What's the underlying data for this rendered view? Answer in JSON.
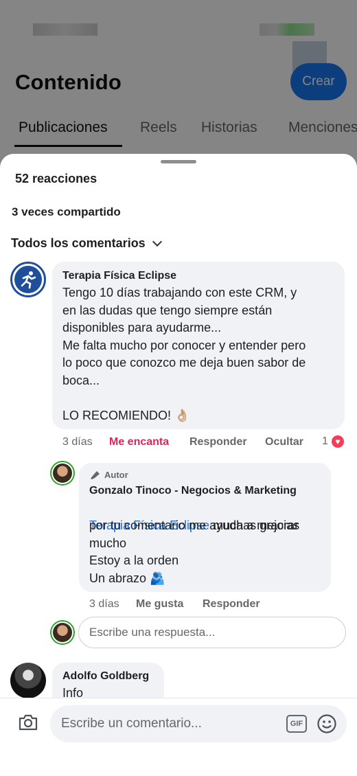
{
  "header": {
    "title": "Contenido",
    "create_label": "Crear",
    "tabs": [
      {
        "label": "Publicaciones",
        "active": true
      },
      {
        "label": "Reels"
      },
      {
        "label": "Historias"
      },
      {
        "label": "Menciones"
      }
    ]
  },
  "sheet": {
    "reactions": "52 reacciones",
    "shares": "3 veces compartido",
    "filter_label": "Todos los comentarios"
  },
  "comments": [
    {
      "author": "Terapia Física Eclipse",
      "text": "Tengo 10 días trabajando con este CRM, y\nen las dudas que tengo siempre están\ndisponibles para ayudarme...\nMe falta mucho por conocer y entender pero\nlo poco que conozco me deja buen sabor de\nboca...\n\nLO RECOMIENDO! 👌🏼",
      "time": "3 días",
      "reaction_label": "Me encanta",
      "reply_label": "Responder",
      "hide_label": "Ocultar",
      "reaction_count": "1"
    },
    {
      "author_tag": "Autor",
      "author": "Gonzalo Tinoco - Negocios & Marketing",
      "mention": "Terapia Física Eclipse",
      "text_after_mention": " muchas gracias",
      "text": "por tu comentario me ayuda a mejorar\nmucho\nEstoy a la orden\nUn abrazo 🫂",
      "time": "3 días",
      "like_label": "Me gusta",
      "reply_label": "Responder"
    },
    {
      "author": "Adolfo Goldberg",
      "text": "Info"
    }
  ],
  "reply_input": {
    "placeholder": "Escribe una respuesta..."
  },
  "comment_input": {
    "placeholder": "Escribe un comentario..."
  },
  "icons": {
    "camera": "camera-icon",
    "gif": "GIF",
    "emoji": "emoji-icon",
    "heart": "heart-icon"
  },
  "colors": {
    "accent": "#1877f2",
    "love": "#e0245e",
    "link": "#216fdb"
  }
}
